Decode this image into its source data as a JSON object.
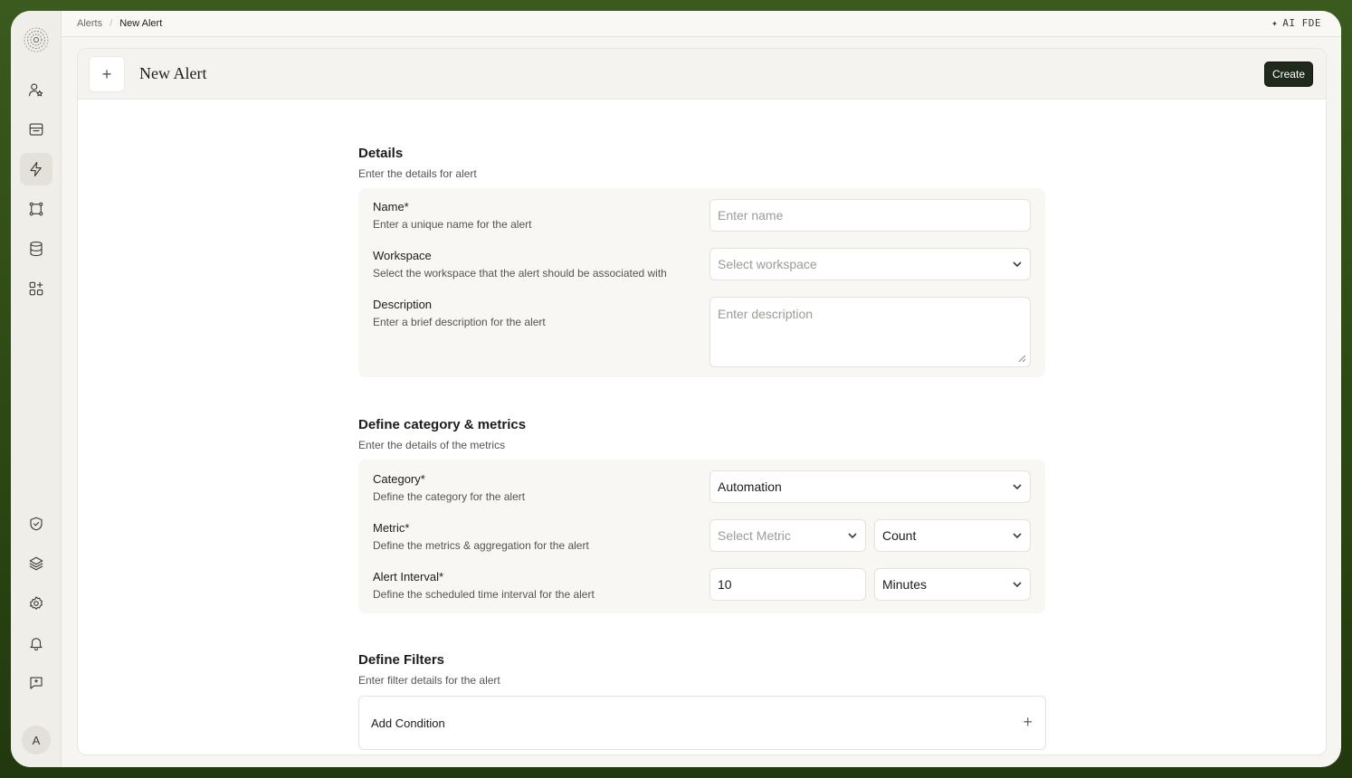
{
  "breadcrumb": [
    "Alerts",
    "New Alert"
  ],
  "topbar": {
    "ai_label": "AI FDE"
  },
  "header": {
    "title": "New Alert",
    "create_label": "Create"
  },
  "avatar_initial": "A",
  "sidebar": {
    "top_icons": [
      "user-star-icon",
      "inbox-icon",
      "lightning-icon",
      "workflow-icon",
      "database-icon",
      "apps-icon"
    ],
    "bottom_icons": [
      "shield-check-icon",
      "layers-icon",
      "gear-icon",
      "bell-icon",
      "feedback-icon"
    ],
    "active": "lightning-icon"
  },
  "details": {
    "title": "Details",
    "subtitle": "Enter the details for alert",
    "name": {
      "label": "Name*",
      "help": "Enter a unique name for the alert",
      "placeholder": "Enter name"
    },
    "workspace": {
      "label": "Workspace",
      "help": "Select the workspace that the alert should be associated with",
      "placeholder": "Select workspace"
    },
    "description": {
      "label": "Description",
      "help": "Enter a brief description for the alert",
      "placeholder": "Enter description"
    }
  },
  "metrics": {
    "title": "Define category & metrics",
    "subtitle": "Enter the details of the metrics",
    "category": {
      "label": "Category*",
      "help": "Define the category for the alert",
      "value": "Automation"
    },
    "metric": {
      "label": "Metric*",
      "help": "Define the metrics & aggregation for the alert",
      "placeholder": "Select Metric",
      "aggregation": "Count"
    },
    "interval": {
      "label": "Alert Interval*",
      "help": "Define the scheduled time interval for the alert",
      "value": "10",
      "unit": "Minutes"
    }
  },
  "filters": {
    "title": "Define Filters",
    "subtitle": "Enter filter details for the alert",
    "add_label": "Add Condition"
  }
}
